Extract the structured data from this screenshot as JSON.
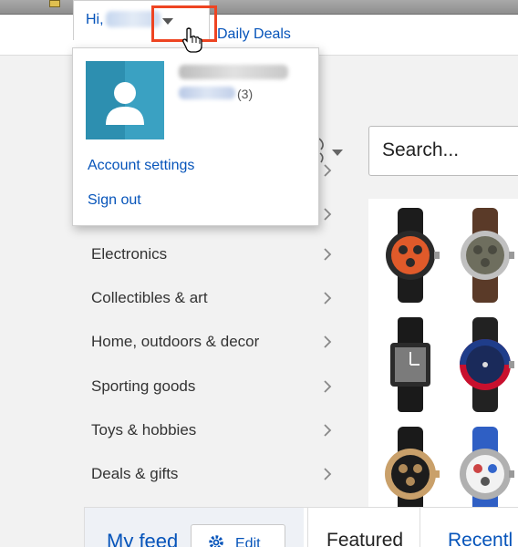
{
  "header": {
    "greeting": "Hi,",
    "daily_deals": "Daily Deals"
  },
  "account_menu": {
    "feedback_score": "(3)",
    "items": [
      {
        "label": "Account settings"
      },
      {
        "label": "Sign out"
      }
    ]
  },
  "search": {
    "placeholder": "Search..."
  },
  "categories": [
    {
      "label": "Electronics"
    },
    {
      "label": "Collectibles & art"
    },
    {
      "label": "Home, outdoors & decor"
    },
    {
      "label": "Sporting goods"
    },
    {
      "label": "Toys & hobbies"
    },
    {
      "label": "Deals & gifts"
    }
  ],
  "bottom": {
    "my_feed": "My feed",
    "edit": "Edit",
    "featured": "Featured",
    "recently": "Recentl"
  },
  "colors": {
    "link": "#0654ba",
    "highlight": "#ee4422",
    "avatar": "#2d8fb0"
  }
}
